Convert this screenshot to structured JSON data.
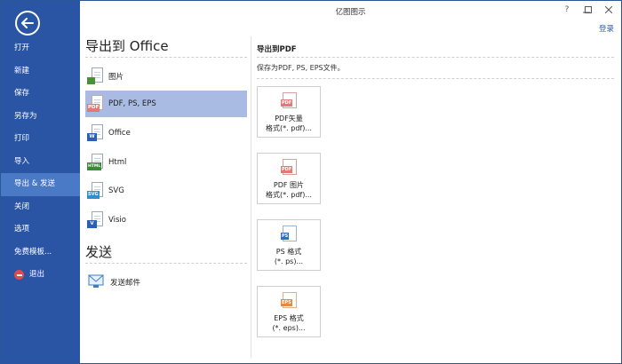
{
  "window": {
    "title": "亿图图示",
    "login": "登录"
  },
  "sidebar": {
    "items": [
      {
        "label": "打开"
      },
      {
        "label": "新建"
      },
      {
        "label": "保存"
      },
      {
        "label": "另存为"
      },
      {
        "label": "打印"
      },
      {
        "label": "导入"
      },
      {
        "label": "导出 & 发送"
      },
      {
        "label": "关闭"
      },
      {
        "label": "选项"
      },
      {
        "label": "免费模板..."
      },
      {
        "label": "退出"
      }
    ],
    "active_index": 6
  },
  "export": {
    "title": "导出到 Office",
    "items": [
      {
        "label": "图片",
        "icon": "image-icon",
        "tag": "",
        "color": "#4a8f3a"
      },
      {
        "label": "PDF, PS, EPS",
        "icon": "pdf-icon",
        "tag": "PDF",
        "color": "#e07a7a"
      },
      {
        "label": "Office",
        "icon": "word-icon",
        "tag": "W",
        "color": "#2b5fb5"
      },
      {
        "label": "Html",
        "icon": "html-icon",
        "tag": "HTML",
        "color": "#3a8a3a"
      },
      {
        "label": "SVG",
        "icon": "svg-icon",
        "tag": "SVG",
        "color": "#2e8fd0"
      },
      {
        "label": "Visio",
        "icon": "visio-icon",
        "tag": "V",
        "color": "#2b5fb5"
      }
    ]
  },
  "send": {
    "title": "发送",
    "items": [
      {
        "label": "发送邮件",
        "icon": "email-icon"
      }
    ]
  },
  "panel": {
    "title": "导出到PDF",
    "description": "保存为PDF, PS, EPS文件。",
    "cards": [
      {
        "line1": "PDF矢量",
        "line2": "格式(*. pdf)...",
        "tag": "PDF",
        "color": "#e07a7a",
        "icon": "pdf-vector-icon"
      },
      {
        "line1": "PDF 图片",
        "line2": "格式(*. pdf)...",
        "tag": "PDF",
        "color": "#e07a7a",
        "icon": "pdf-image-icon"
      },
      {
        "line1": "PS 格式",
        "line2": "(*. ps)...",
        "tag": "PS",
        "color": "#2e6fc0",
        "icon": "ps-icon"
      },
      {
        "line1": "EPS 格式",
        "line2": "(*. eps)...",
        "tag": "EPS",
        "color": "#e08a4a",
        "icon": "eps-icon"
      }
    ]
  }
}
